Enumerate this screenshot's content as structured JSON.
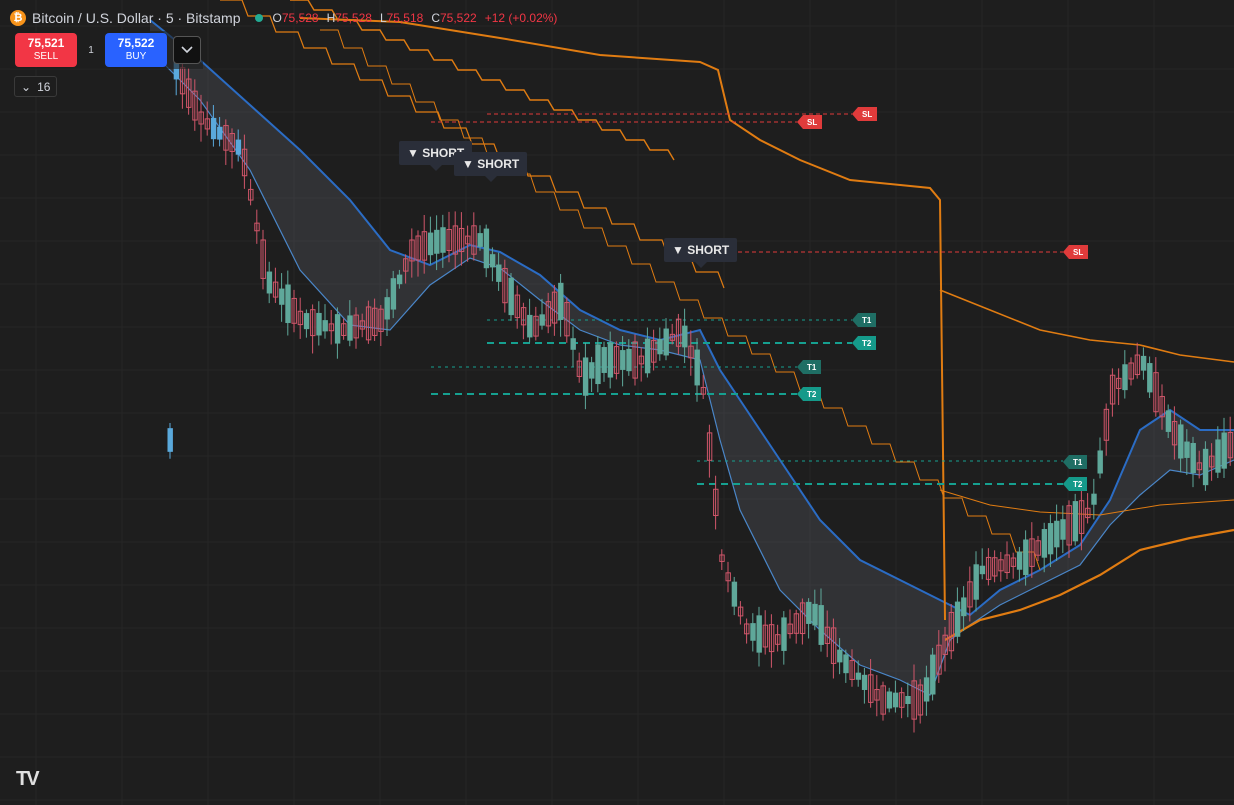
{
  "symbol": {
    "title": "Bitcoin / U.S. Dollar · 5 · Bitstamp",
    "icon": "bitcoin-icon",
    "icon_glyph": "₿",
    "ohlc": {
      "o_label": "O",
      "o": "75,528",
      "h_label": "H",
      "h": "75,528",
      "l_label": "L",
      "l": "75,518",
      "c_label": "C",
      "c": "75,522",
      "change": "+12 (+0.02%)"
    }
  },
  "trade": {
    "sell_price": "75,521",
    "sell_label": "SELL",
    "qty": "1",
    "buy_price": "75,522",
    "buy_label": "BUY",
    "expand_icon": "chevron-down-icon"
  },
  "indicators": {
    "toggle_glyph": "⌄",
    "count": "16"
  },
  "signals": [
    "▼ SHORT",
    "▼ SHORT",
    "▼ SHORT"
  ],
  "tags": {
    "sl": "SL",
    "t1": "T1",
    "t2": "T2"
  },
  "logo": "TV",
  "colors": {
    "background": "#1e1e1e",
    "candle_up": "#5fa89a",
    "candle_down": "#d0566a",
    "candle_blue": "#5aa9dc",
    "ema_band": "#2b6cc4",
    "trail_orange": "#e07c12",
    "sl_line": "#e03b3b",
    "target_line": "#16a090"
  }
}
